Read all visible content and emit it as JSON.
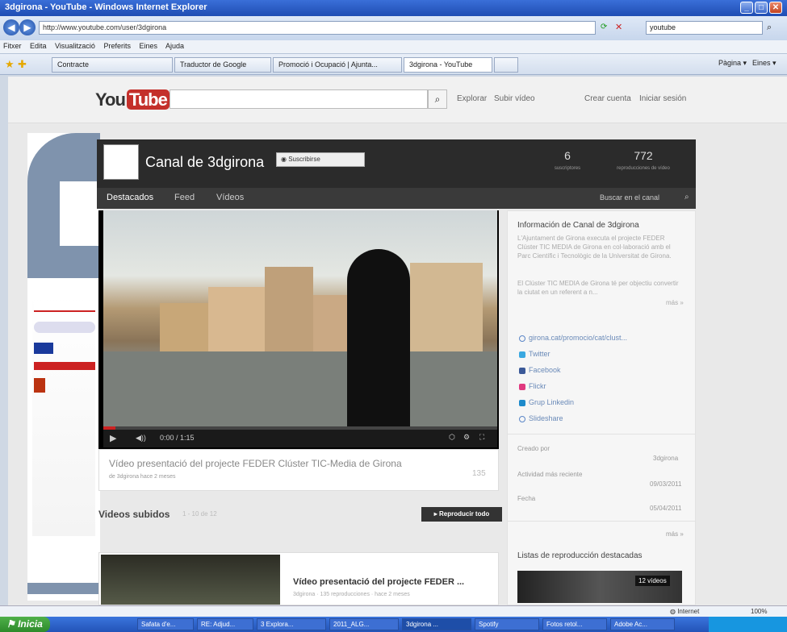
{
  "window": {
    "title": "3dgirona - YouTube - Windows Internet Explorer"
  },
  "browser": {
    "url": "http://www.youtube.com/user/3dgirona",
    "search_value": "youtube",
    "menu": [
      "Fitxer",
      "Edita",
      "Visualització",
      "Preferits",
      "Eines",
      "Ajuda"
    ],
    "tabs": [
      "Contracte",
      "Traductor de Google",
      "Promoció i Ocupació | Ajunta...",
      "3dgirona - YouTube",
      ""
    ],
    "right_tools": [
      "Pàgina ▾",
      "Eines ▾"
    ]
  },
  "youtube": {
    "logo_you": "You",
    "logo_tube": "Tube",
    "search_placeholder": "",
    "links": [
      "Explorar",
      "Subir vídeo",
      "Crear cuenta",
      "Iniciar sesión"
    ]
  },
  "channel": {
    "title": "Canal de 3dgirona",
    "subscribe": "Suscribirse",
    "stats": [
      {
        "value": "6",
        "label": "suscriptores"
      },
      {
        "value": "772",
        "label": "reproducciones de vídeo"
      }
    ],
    "tabs": [
      "Destacados",
      "Feed",
      "Vídeos"
    ],
    "search_placeholder": "Buscar en el canal"
  },
  "player": {
    "time": "0:00 / 1:15",
    "progress": 0.03,
    "video_title": "Vídeo presentació del projecte FEDER Clúster TIC-Media de Girona",
    "video_meta": "de 3dgirona hace 2 meses",
    "views": "135"
  },
  "sidebar": {
    "info_title": "Información de Canal de 3dgirona",
    "info_text_1": "L'Ajuntament de Girona executa el projecte FEDER Clúster TIC MEDIA de Girona en col·laboració amb el Parc Científic i Tecnològic de la Universitat de Girona.",
    "info_text_2": "El Clúster TIC MEDIA de Girona té per objectiu convertir la ciutat en un referent a n...",
    "more": "más »",
    "links": [
      {
        "label": "girona.cat/promocio/cat/clust...",
        "color": "#5b86c7"
      },
      {
        "label": "Twitter",
        "color": "#3aa8e0"
      },
      {
        "label": "Facebook",
        "color": "#3b5998"
      },
      {
        "label": "Flickr",
        "color": "#e0397f"
      },
      {
        "label": "Grup Linkedin",
        "color": "#1d8acb"
      },
      {
        "label": "Slideshare",
        "color": "#5b86c7"
      }
    ],
    "created_by_label": "Creado por",
    "created_by": "3dgirona",
    "activity_label": "Actividad más reciente",
    "activity": "09/03/2011",
    "date_label": "Fecha",
    "date": "05/04/2011",
    "more2": "más »",
    "playlists_title": "Listas de reproducción destacadas",
    "playlist_badge": "12 vídeos"
  },
  "uploads": {
    "title": "Videos subidos",
    "count": "1 - 10 de 12",
    "play_all": "▸ Reproducir todo",
    "item_title": "Vídeo presentació del projecte FEDER ...",
    "item_meta": "3dgirona · 135 reproducciones · hace 2 meses"
  },
  "statusbar": {
    "zone": "Internet",
    "zoom": "100%"
  },
  "taskbar": {
    "start": "Inicia",
    "tasks": [
      "Safata d'e...",
      "RE: Adjud...",
      "3 Explora...",
      "2011_ALG...",
      "3dgirona ...",
      "Spotify",
      "Fotos retol...",
      "Adobe Ac..."
    ]
  }
}
